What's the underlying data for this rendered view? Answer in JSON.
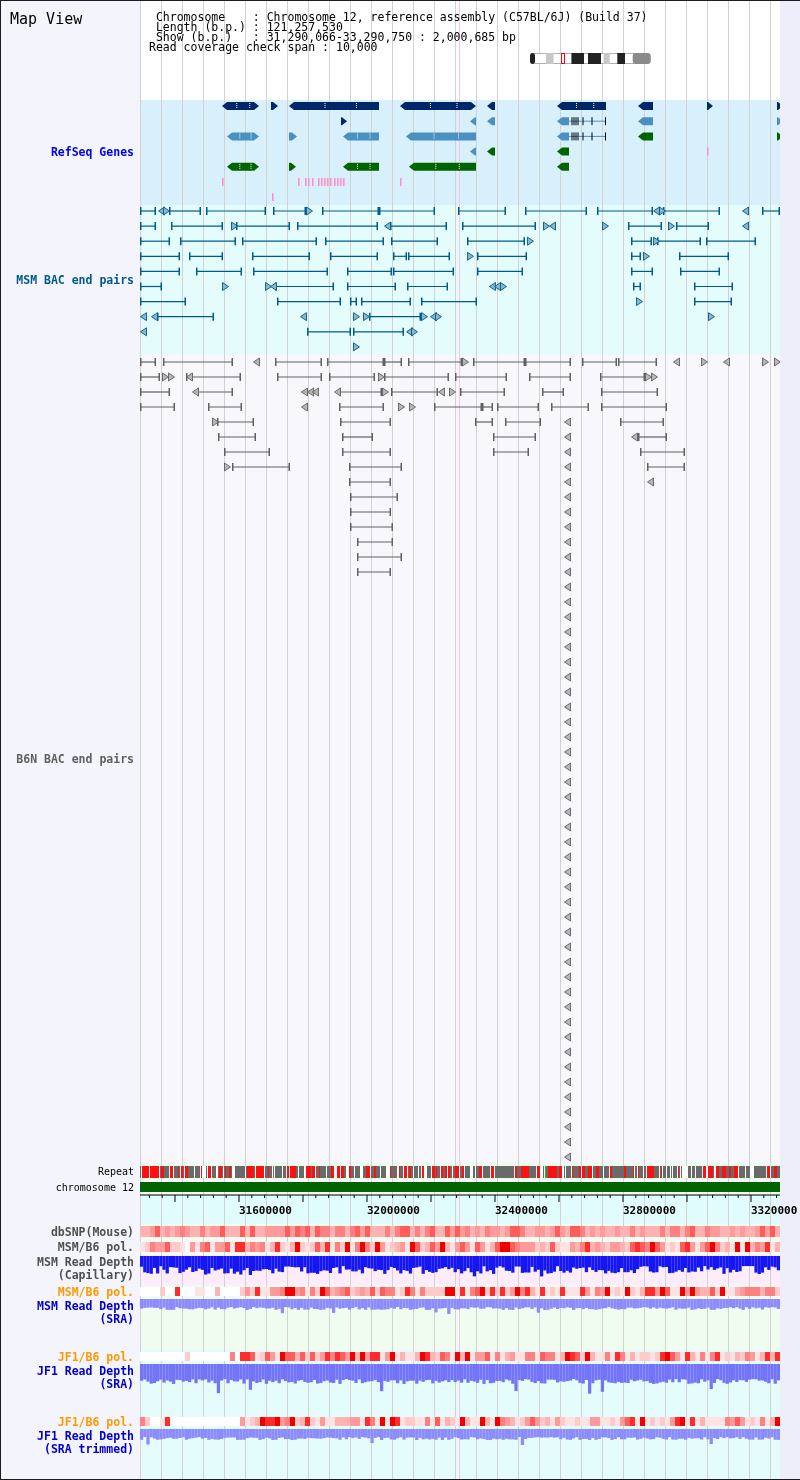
{
  "panel": {
    "title": "Map View"
  },
  "header": {
    "rows": [
      {
        "label": "Chromosome",
        "separator": ":",
        "value": "Chromosome 12, reference assembly (C57BL/6J) (Build 37)"
      },
      {
        "label": "Length (b.p.)",
        "separator": ":",
        "value": "121,257,530"
      },
      {
        "label": "Show (b.p.)",
        "separator": ":",
        "value": "31,290,066-33,290,750 : 2,000,685 bp"
      }
    ],
    "coverage": {
      "label": "Read coverage check span",
      "separator": ":",
      "value": "10,000"
    }
  },
  "tracks": [
    {
      "kind": "genes",
      "label": "RefSeq Genes",
      "color": "#0000ee"
    },
    {
      "kind": "pairs",
      "label": "MSM BAC end pairs",
      "color": "#005a8c"
    },
    {
      "kind": "pairs",
      "label": "B6N BAC end pairs",
      "color": "#606060"
    },
    {
      "kind": "repeat",
      "label": "Repeat"
    },
    {
      "kind": "chromosome",
      "label": "chromosome 12"
    },
    {
      "kind": "axis",
      "tick_labels": [
        "31600000",
        "32000000",
        "32400000",
        "32800000",
        "3320000"
      ]
    },
    {
      "kind": "heat",
      "label": "dbSNP(Mouse)",
      "color": "#505050"
    },
    {
      "kind": "heat",
      "label": "MSM/B6 pol.",
      "color": "#505050"
    },
    {
      "kind": "depth",
      "label": "MSM Read Depth",
      "sublabel": "(Capillary)",
      "color": "#505050"
    },
    {
      "kind": "heat",
      "label": "MSM/B6 pol.",
      "color": "#ff9900"
    },
    {
      "kind": "depth",
      "label": "MSM Read Depth",
      "sublabel": "(SRA)",
      "color": "#0000cc"
    },
    {
      "kind": "heat",
      "label": "JF1/B6 pol.",
      "color": "#ff9900"
    },
    {
      "kind": "depth",
      "label": "JF1 Read Depth",
      "sublabel": "(SRA)",
      "color": "#0000cc"
    },
    {
      "kind": "heat",
      "label": "JF1/B6 pol.",
      "color": "#ff9900"
    },
    {
      "kind": "depth",
      "label": "JF1 Read Depth",
      "sublabel": "(SRA trimmed)",
      "color": "#0000cc"
    }
  ]
}
